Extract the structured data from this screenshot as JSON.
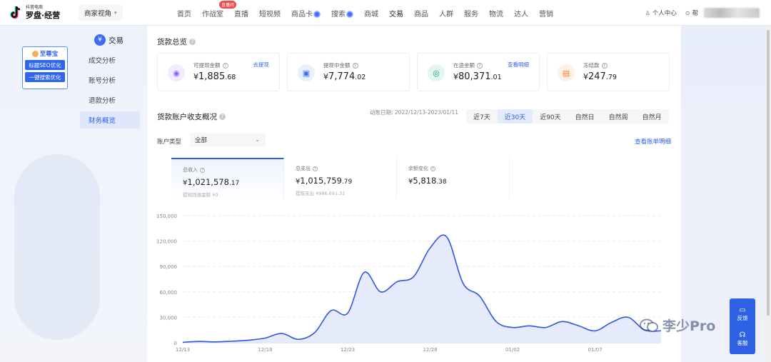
{
  "topnav": {
    "logo_small": "抖音电商",
    "logo_main": "罗盘·经营",
    "view_switch": "商家视角",
    "menu": [
      {
        "label": "首页"
      },
      {
        "label": "作战室",
        "badge": "直播间"
      },
      {
        "label": "直播"
      },
      {
        "label": "短视频"
      },
      {
        "label": "商品卡",
        "dot": true
      },
      {
        "label": "搜索",
        "dot": true
      },
      {
        "label": "商城"
      },
      {
        "label": "交易",
        "active": true
      },
      {
        "label": "商品"
      },
      {
        "label": "人群"
      },
      {
        "label": "服务"
      },
      {
        "label": "物流"
      },
      {
        "label": "达人"
      },
      {
        "label": "营销"
      }
    ],
    "personal_center": "个人中心",
    "help": "帮"
  },
  "promo": {
    "title": "至尊宝",
    "btn1": "标题SEO优化",
    "btn2": "一键搜索优化"
  },
  "sidebar": {
    "head": "交易",
    "head_icon": "¥",
    "items": [
      {
        "label": "成交分析"
      },
      {
        "label": "账号分析"
      },
      {
        "label": "退款分析"
      },
      {
        "label": "财务概览",
        "active": true
      }
    ]
  },
  "overview": {
    "title": "货款总览",
    "cards": [
      {
        "label": "可提现金额",
        "link": "去提现",
        "currency": "¥",
        "int": "1,885",
        "dec": ".68",
        "icon": "wallet-icon",
        "icon_color": "#8b5cf6",
        "icon_bg": "#f1ebff",
        "glyph": "◉"
      },
      {
        "label": "提现中金额",
        "link": "",
        "currency": "¥",
        "int": "7,774",
        "dec": ".02",
        "icon": "card-icon",
        "icon_color": "#3f6df0",
        "icon_bg": "#e8efff",
        "glyph": "▣"
      },
      {
        "label": "在途金额",
        "link": "查看明细",
        "currency": "¥",
        "int": "80,371",
        "dec": ".01",
        "icon": "coins-icon",
        "icon_color": "#12a572",
        "icon_bg": "#e3f7ef",
        "glyph": "◎"
      },
      {
        "label": "冻结款",
        "link": "",
        "currency": "¥",
        "int": "247",
        "dec": ".79",
        "icon": "lock-icon",
        "icon_color": "#f07a2e",
        "icon_bg": "#fff0e6",
        "glyph": "▤"
      }
    ]
  },
  "flow": {
    "title": "货款账户收支概况",
    "date_label": "动账日期: 2022/12/13-2023/01/11",
    "ranges": [
      {
        "label": "近7天"
      },
      {
        "label": "近30天",
        "active": true
      },
      {
        "label": "近90天"
      },
      {
        "label": "自然日"
      },
      {
        "label": "自然周"
      },
      {
        "label": "自然月"
      }
    ],
    "account_type_label": "账户类型",
    "account_type_value": "全部",
    "detail_link": "查看账单明细",
    "summaries": [
      {
        "label": "总收入",
        "currency": "¥",
        "int": "1,021,578",
        "dec": ".17",
        "sub": "提现回退金额 ¥0",
        "active": true
      },
      {
        "label": "总支出",
        "currency": "¥",
        "int": "1,015,759",
        "dec": ".79",
        "sub": "提现支出 ¥986,691.31"
      },
      {
        "label": "余额变化",
        "currency": "¥",
        "int": "5,818",
        "dec": ".38",
        "sub": ""
      }
    ]
  },
  "chart_data": {
    "type": "area",
    "x": [
      "12/13",
      "12/14",
      "12/15",
      "12/16",
      "12/17",
      "12/18",
      "12/19",
      "12/20",
      "12/21",
      "12/22",
      "12/23",
      "12/24",
      "12/25",
      "12/26",
      "12/27",
      "12/28",
      "12/29",
      "12/30",
      "12/31",
      "01/01",
      "01/02",
      "01/03",
      "01/04",
      "01/05",
      "01/06",
      "01/07",
      "01/08",
      "01/09",
      "01/10",
      "01/11"
    ],
    "values": [
      500,
      1500,
      1000,
      1800,
      3000,
      5500,
      11000,
      4000,
      12000,
      38000,
      35000,
      83000,
      60000,
      72000,
      78000,
      112000,
      125000,
      70000,
      55000,
      25000,
      18000,
      20000,
      18000,
      25000,
      20000,
      14000,
      24000,
      30000,
      15000,
      14000
    ],
    "x_tick_labels": [
      "12/13",
      "12/18",
      "12/23",
      "12/28",
      "01/02",
      "01/07"
    ],
    "y_ticks": [
      0,
      30000,
      60000,
      90000,
      120000,
      150000
    ],
    "y_tick_labels": [
      "0",
      "30,000",
      "60,000",
      "90,000",
      "120,000",
      "150,000"
    ],
    "ylim": [
      0,
      150000
    ],
    "line_color": "#2e55e6",
    "fill_color": "#e2e8fb",
    "grid": true
  },
  "float": {
    "feedback": "反馈",
    "service": "客服"
  },
  "watermark": {
    "text": "李少Pro"
  }
}
